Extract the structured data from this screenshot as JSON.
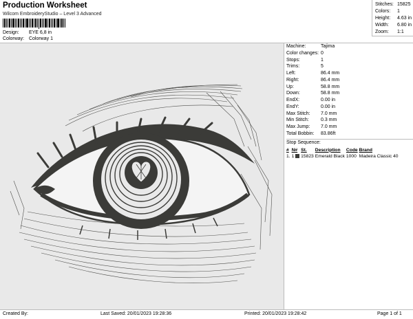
{
  "header": {
    "title": "Production Worksheet",
    "subtitle": "Wilcom EmbroideryStudio – Level 3 Advanced",
    "design_label": "Design:",
    "design_value": "EYE 6,8 in",
    "colorway_label": "Colorway:",
    "colorway_value": "Colorway 1"
  },
  "summary": [
    {
      "label": "Stitches:",
      "value": "15825"
    },
    {
      "label": "Colors:",
      "value": "1"
    },
    {
      "label": "Height:",
      "value": "4.63 in"
    },
    {
      "label": "Width:",
      "value": "6.80 in"
    },
    {
      "label": "Zoom:",
      "value": "1:1"
    }
  ],
  "stats": [
    {
      "label": "Machine:",
      "value": "Tajima"
    },
    {
      "label": "Color changes:",
      "value": "0"
    },
    {
      "label": "Stops:",
      "value": "1"
    },
    {
      "label": "Trims:",
      "value": "5"
    },
    {
      "label": "Left:",
      "value": "86.4 mm"
    },
    {
      "label": "Right:",
      "value": "86.4 mm"
    },
    {
      "label": "Up:",
      "value": "58.8 mm"
    },
    {
      "label": "Down:",
      "value": "58.8 mm"
    },
    {
      "label": "EndX:",
      "value": "0.00 in"
    },
    {
      "label": "EndY:",
      "value": "0.00 in"
    },
    {
      "label": "Max Stitch:",
      "value": "7.0 mm"
    },
    {
      "label": "Min Stitch:",
      "value": "0.3 mm"
    },
    {
      "label": "Max Jump:",
      "value": "7.0 mm"
    },
    {
      "label": "Total Bobbin:",
      "value": "83.86ft"
    }
  ],
  "stop_sequence": {
    "title": "Stop Sequence:",
    "headers": [
      "#",
      "N#",
      "St.",
      "Description",
      "Code",
      "Brand"
    ],
    "rows": [
      {
        "num": "1.",
        "n": "1",
        "st": "15823",
        "description": "Emerald Black",
        "code": "1000",
        "brand": "Madeira Classic 40",
        "color": "#3b3b38"
      }
    ]
  },
  "footer": {
    "created": "Created By:",
    "last_saved": "Last Saved: 20/01/2023 19:28:36",
    "printed": "Printed: 20/01/2023 19:28:42",
    "page": "Page 1 of 1"
  },
  "colors": {
    "thread": "#3b3b38",
    "canvas": "#e9e9e9"
  }
}
